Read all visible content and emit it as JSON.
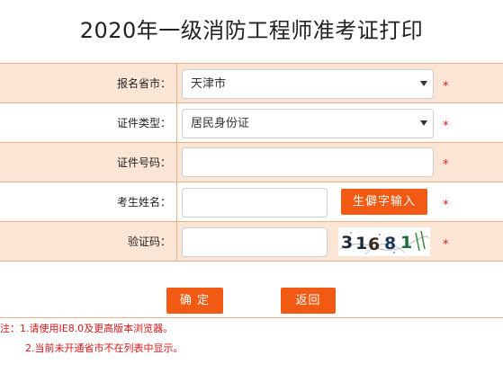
{
  "page": {
    "title": "2020年一级消防工程师准考证打印"
  },
  "form": {
    "province": {
      "label": "报名省市：",
      "value": "天津市",
      "required_mark": "*"
    },
    "id_type": {
      "label": "证件类型：",
      "value": "居民身份证",
      "required_mark": "*"
    },
    "id_number": {
      "label": "证件号码：",
      "value": "",
      "required_mark": "*"
    },
    "name": {
      "label": "考生姓名：",
      "value": "",
      "rare_char_button": "生僻字输入",
      "required_mark": "*"
    },
    "captcha": {
      "label": "验证码：",
      "value": "",
      "image_text": "31681",
      "required_mark": "*"
    }
  },
  "actions": {
    "confirm": "确 定",
    "back": "返回"
  },
  "notes": [
    "注：1.请使用IE8.0及更高版本浏览器。",
    "2.当前未开通省市不在列表中显示。"
  ],
  "colors": {
    "accent": "#f25a14",
    "row_alt_bg": "#fbe5d4",
    "border": "#e8b08a",
    "required": "#e02020",
    "note_text": "#d41818"
  }
}
